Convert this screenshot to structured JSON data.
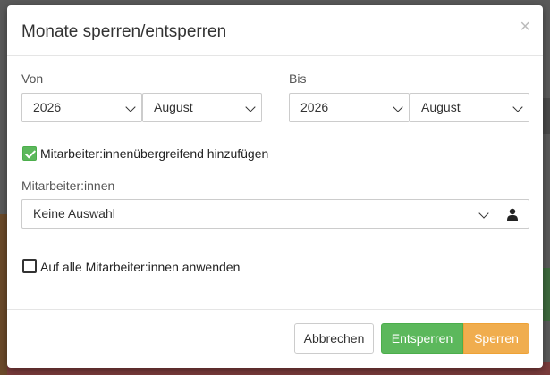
{
  "dialog": {
    "title": "Monate sperren/entsperren",
    "close_glyph": "×"
  },
  "von": {
    "label": "Von",
    "year": "2026",
    "month": "August"
  },
  "bis": {
    "label": "Bis",
    "year": "2026",
    "month": "August"
  },
  "cross_employee": {
    "label": "Mitarbeiter:innenübergreifend hinzufügen",
    "checked": true
  },
  "employees": {
    "label": "Mitarbeiter:innen",
    "value": "Keine Auswahl",
    "button_icon": "user-icon"
  },
  "apply_all": {
    "label": "Auf alle Mitarbeiter:innen anwenden",
    "checked": false
  },
  "footer": {
    "cancel_label": "Abbrechen",
    "unlock_label": "Entsperren",
    "lock_label": "Sperren"
  },
  "colors": {
    "success": "#5cb85c",
    "warning": "#f0ad4e"
  }
}
